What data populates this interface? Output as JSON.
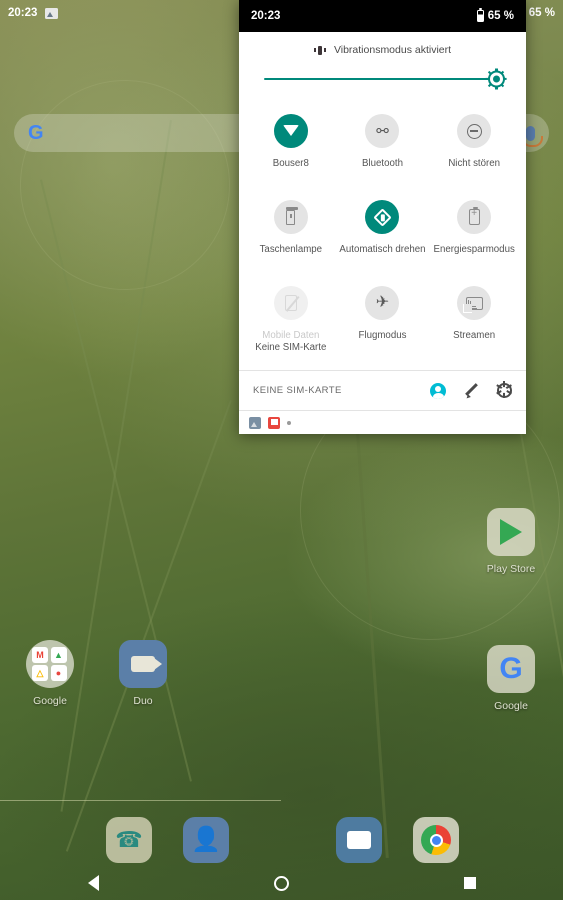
{
  "statusbar": {
    "time": "20:23",
    "battery": "65 %",
    "image_icon": "image-icon"
  },
  "panel": {
    "statusbar": {
      "time": "20:23",
      "battery": "65 %"
    },
    "vibration_notice": "Vibrationsmodus aktiviert",
    "brightness": {
      "label": "Helligkeit",
      "value": 100
    },
    "tiles": [
      {
        "label": "Bouser8",
        "sub": "",
        "state": "on",
        "icon": "wifi-icon"
      },
      {
        "label": "Bluetooth",
        "sub": "",
        "state": "off_light",
        "icon": "bluetooth-icon"
      },
      {
        "label": "Nicht stören",
        "sub": "",
        "state": "off_light",
        "icon": "do-not-disturb-icon"
      },
      {
        "label": "Taschenlampe",
        "sub": "",
        "state": "off_light",
        "icon": "flashlight-icon"
      },
      {
        "label": "Automatisch drehen",
        "sub": "",
        "state": "on",
        "icon": "auto-rotate-icon"
      },
      {
        "label": "Energiesparmodus",
        "sub": "",
        "state": "off_light",
        "icon": "battery-saver-icon"
      },
      {
        "label": "Mobile Daten",
        "sub": "Keine SIM-Karte",
        "state": "disabled",
        "icon": "no-sim-icon"
      },
      {
        "label": "Flugmodus",
        "sub": "",
        "state": "off_light",
        "icon": "airplane-icon"
      },
      {
        "label": "Streamen",
        "sub": "",
        "state": "off_light",
        "icon": "cast-icon"
      }
    ],
    "footer": {
      "carrier": "KEINE SIM-KARTE",
      "user_icon": "user-avatar-icon",
      "edit_icon": "pencil-icon",
      "settings_icon": "gear-icon"
    },
    "notifications": [
      {
        "icon": "screenshot-image-icon"
      },
      {
        "icon": "app-red-icon"
      },
      {
        "icon": "more-dot-icon"
      }
    ]
  },
  "homescreen": {
    "search": {
      "logo": "google-g-logo",
      "mic": "microphone-icon",
      "placeholder": ""
    },
    "icons": [
      {
        "label": "Google",
        "type": "folder"
      },
      {
        "label": "Duo",
        "type": "duo"
      },
      {
        "label": "Play Store",
        "type": "playstore"
      },
      {
        "label": "Google",
        "type": "google"
      }
    ],
    "dock": [
      {
        "label": "Telefon",
        "icon": "phone-icon"
      },
      {
        "label": "Kontakte",
        "icon": "contacts-icon"
      },
      {
        "label": "Nachrichten",
        "icon": "messages-icon"
      },
      {
        "label": "Chrome",
        "icon": "chrome-icon"
      }
    ]
  },
  "navbar": {
    "back": "back-icon",
    "home": "home-icon",
    "recents": "recents-icon"
  },
  "colors": {
    "accent_teal": "#00897b",
    "tile_off": "#e4e4e4",
    "panel_bg": "#ffffff",
    "user_cyan": "#00bcd4"
  }
}
